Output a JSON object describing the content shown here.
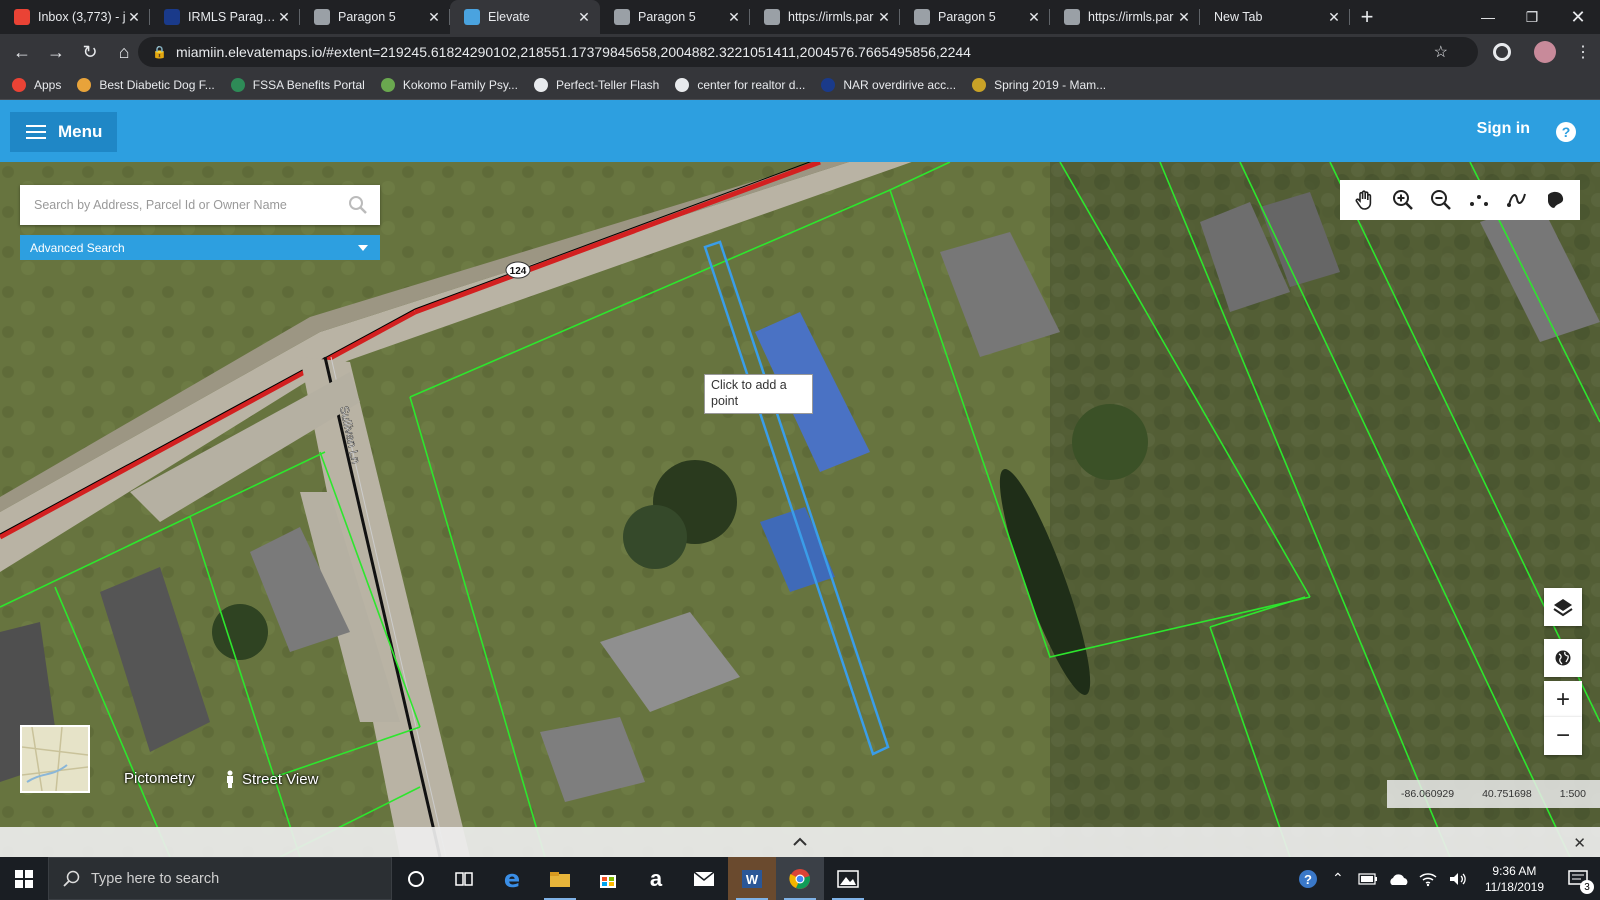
{
  "browser": {
    "tabs": [
      {
        "title": "Inbox (3,773) - j",
        "icon": "gmail-icon",
        "color": "#ea4335"
      },
      {
        "title": "IRMLS Paragon",
        "icon": "irmls-icon",
        "color": "#1a3a8a"
      },
      {
        "title": "Paragon 5",
        "icon": "paragon-icon",
        "color": "#9aa0a6"
      },
      {
        "title": "Elevate",
        "icon": "elevate-icon",
        "color": "#4aa3df"
      },
      {
        "title": "Paragon 5",
        "icon": "paragon-icon",
        "color": "#9aa0a6"
      },
      {
        "title": "https://irmls.par",
        "icon": "paragon-icon",
        "color": "#9aa0a6"
      },
      {
        "title": "Paragon 5",
        "icon": "paragon-icon",
        "color": "#9aa0a6"
      },
      {
        "title": "https://irmls.par",
        "icon": "paragon-icon",
        "color": "#9aa0a6"
      },
      {
        "title": "New Tab",
        "icon": "",
        "color": ""
      }
    ],
    "active_tab": 3,
    "new_tab_glyph": "+",
    "url": "miamiin.elevatemaps.io/#extent=219245.61824290102,218551.17379845658,2004882.3221051411,2004576.7665495856,2244",
    "bookmarks": [
      {
        "label": "Apps",
        "icon": "apps-grid-icon",
        "color": "#ea4335"
      },
      {
        "label": "Best Diabetic Dog F...",
        "icon": "dog-food-icon",
        "color": "#e8a33a"
      },
      {
        "label": "FSSA Benefits Portal",
        "icon": "fssa-icon",
        "color": "#2e8b57"
      },
      {
        "label": "Kokomo Family Psy...",
        "icon": "kokomo-icon",
        "color": "#6aa84f"
      },
      {
        "label": "Perfect-Teller Flash",
        "icon": "perfect-teller-icon",
        "color": "#e8eaed"
      },
      {
        "label": "center for realtor d...",
        "icon": "realtor-icon",
        "color": "#e8eaed"
      },
      {
        "label": "NAR overdirive acc...",
        "icon": "nar-icon",
        "color": "#1a3a8a"
      },
      {
        "label": "Spring 2019 - Mam...",
        "icon": "spring-icon",
        "color": "#c9a227"
      }
    ]
  },
  "app": {
    "menu_label": "Menu",
    "signin_label": "Sign in",
    "help_glyph": "?",
    "search_placeholder": "Search by Address, Parcel Id or Owner Name",
    "advanced_search_label": "Advanced Search",
    "tooltip": "Click to add a point",
    "road_label": "124",
    "street_label": "Sullivan Ln",
    "pictometry_label": "Pictometry",
    "street_view_label": "Street View",
    "coords": {
      "lon": "-86.060929",
      "lat": "40.751698",
      "scale": "1:500"
    },
    "zoom_in": "+",
    "zoom_out": "−"
  },
  "taskbar": {
    "search_placeholder": "Type here to search",
    "time": "9:36 AM",
    "date": "11/18/2019",
    "notification_count": "3"
  }
}
